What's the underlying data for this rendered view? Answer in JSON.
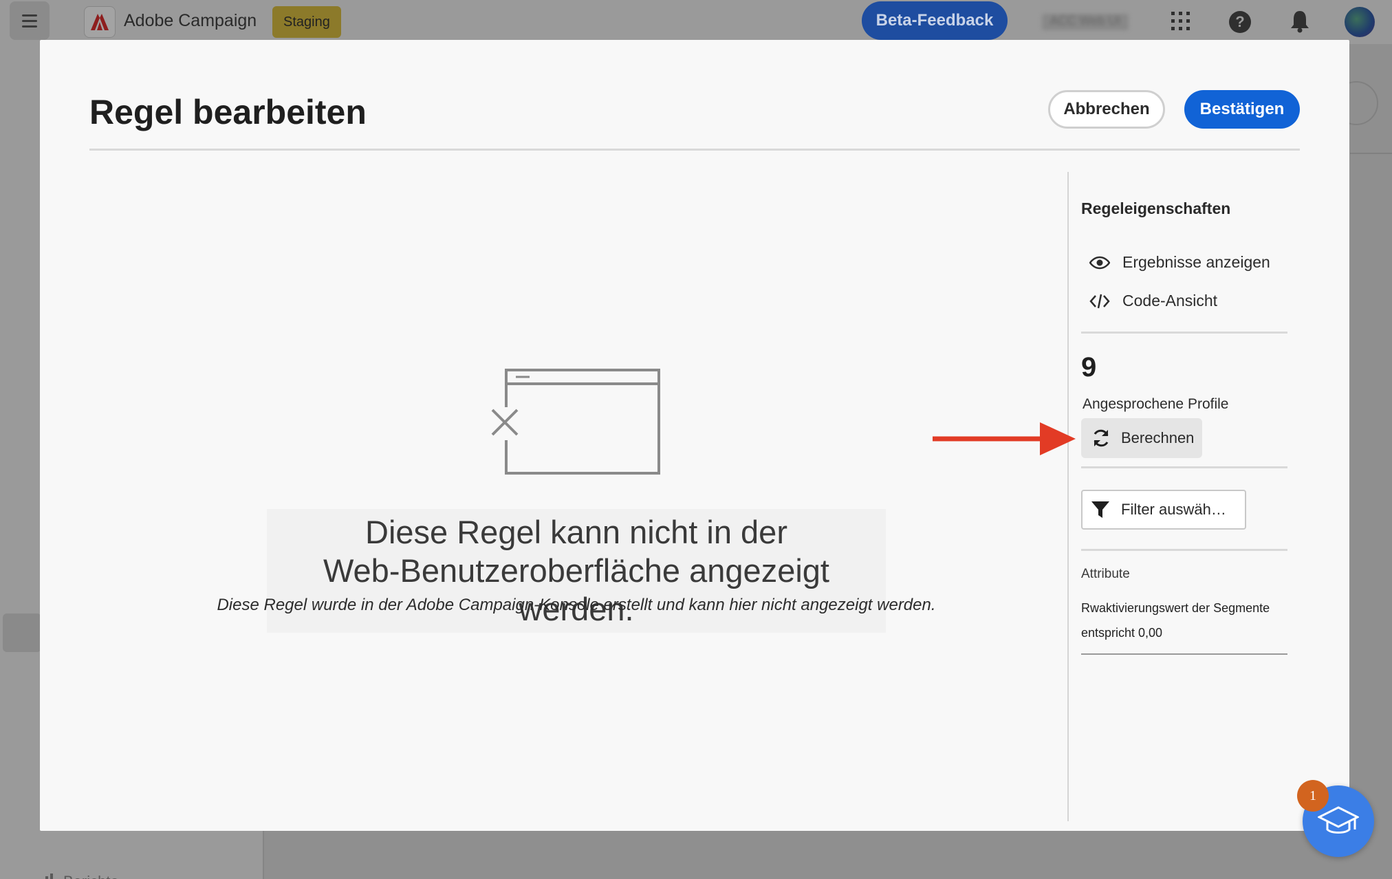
{
  "topbar": {
    "app_name": "Adobe Campaign",
    "environment_badge": "Staging",
    "beta_feedback_label": "Beta-Feedback",
    "org_name": "ACC Web UI",
    "help_glyph": "?",
    "icons": [
      "menu-icon",
      "adobe-logo-icon",
      "apps-grid-icon",
      "help-icon",
      "bell-icon",
      "avatar"
    ]
  },
  "leftrail": {
    "reports_label": "Berichte"
  },
  "modal": {
    "title": "Regel bearbeiten",
    "cancel_label": "Abbrechen",
    "confirm_label": "Bestätigen",
    "empty_state": {
      "title_line1": "Diese Regel kann nicht in der",
      "title_line2": "Web-Benutzeroberfläche angezeigt werden.",
      "subtitle": "Diese Regel wurde in der Adobe Campaign-Konsole erstellt und kann hier nicht angezeigt werden."
    },
    "properties": {
      "title": "Regeleigenschaften",
      "view_results_label": "Ergebnisse anzeigen",
      "code_view_label": "Code-Ansicht",
      "profile_count": "9",
      "profile_count_label": "Angesprochene Profile",
      "compute_label": "Berechnen",
      "filter_label": "Filter auswäh…",
      "attributes_label": "Attribute",
      "attribute_value": "Rwaktivierungswert der Segmente entspricht 0,00"
    }
  },
  "learn_fab": {
    "badge_count": "1"
  },
  "colors": {
    "accent_blue": "#1163d6",
    "annotation_red": "#e23b25",
    "badge_orange": "#d2641f",
    "fab_blue": "#3b7ee6"
  }
}
